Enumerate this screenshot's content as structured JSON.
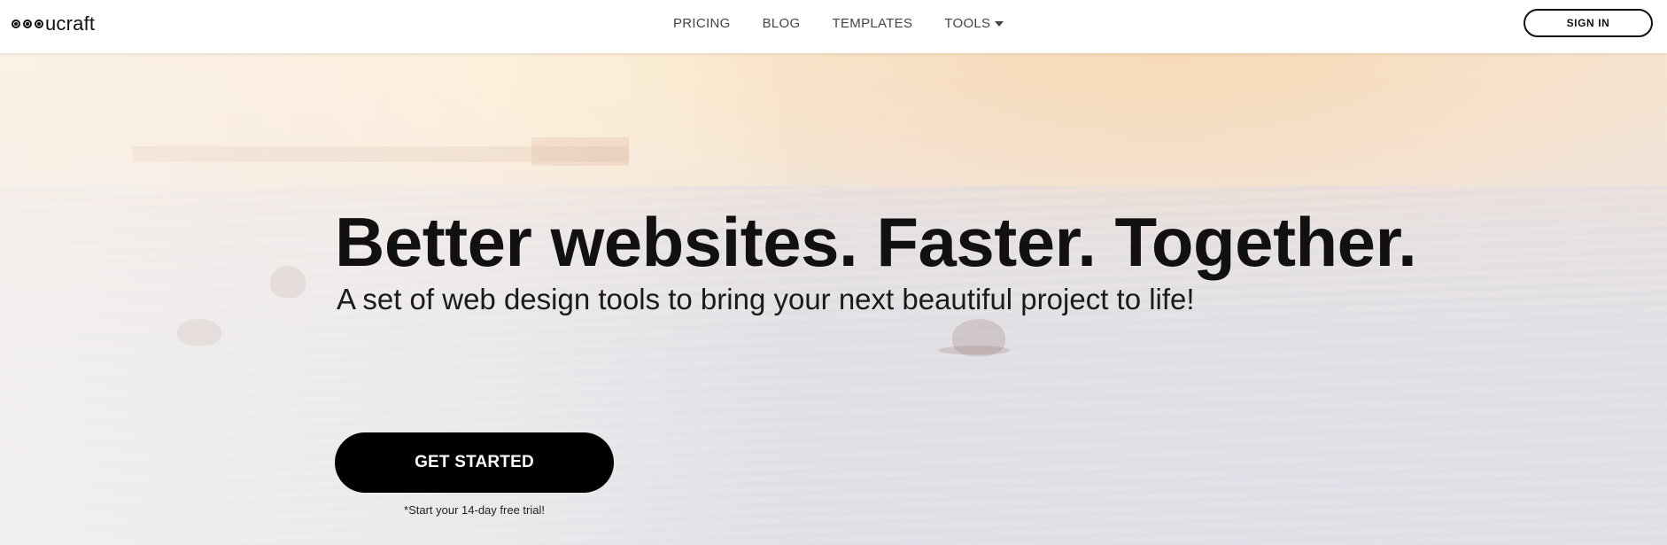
{
  "brand": {
    "logo_text": "ucraft"
  },
  "nav": {
    "items": [
      {
        "label": "PRICING"
      },
      {
        "label": "BLOG"
      },
      {
        "label": "TEMPLATES"
      },
      {
        "label": "TOOLS"
      }
    ],
    "signin_label": "SIGN IN"
  },
  "hero": {
    "title": "Better websites. Faster. Together.",
    "subtitle": "A set of web design tools to bring your next beautiful project to life!",
    "cta_label": "GET STARTED",
    "trial_note": "*Start your 14-day free trial!"
  },
  "colors": {
    "cta_background": "#000000",
    "text": "#111111",
    "nav_text": "#444444"
  },
  "icons": [
    "logo-dots-icon",
    "caret-down-icon"
  ]
}
